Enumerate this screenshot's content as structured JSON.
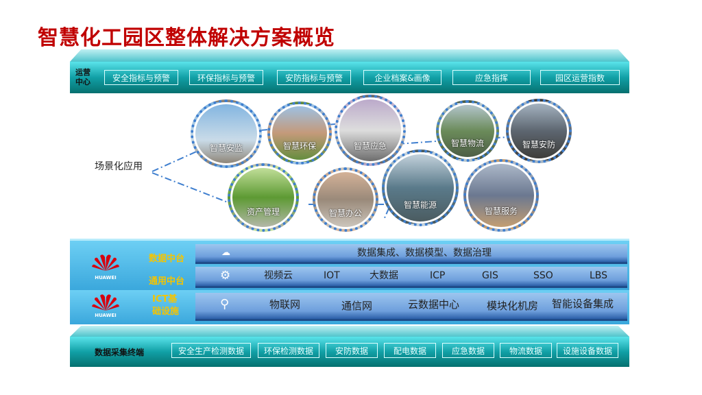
{
  "title": "智慧化工园区整体解决方案概览",
  "ops": {
    "label": "运营中心",
    "buttons": [
      "安全指标与预警",
      "环保指标与预警",
      "安防指标与预警",
      "企业档案&画像",
      "应急指挥",
      "园区运营指数"
    ]
  },
  "scenes": {
    "label": "场景化应用",
    "items": [
      "智慧安监",
      "智慧环保",
      "智慧应急",
      "智慧物流",
      "智慧安防",
      "资产管理",
      "智慧办公",
      "智慧能源",
      "智慧服务"
    ]
  },
  "platform": {
    "brand": "HUAWEI",
    "data_label": "数据中台",
    "general_label": "通用中台",
    "data_text": "数据集成、数据模型、数据治理",
    "general_items": [
      "视频云",
      "IOT",
      "大数据",
      "ICP",
      "GIS",
      "SSO",
      "LBS"
    ]
  },
  "ict": {
    "brand": "HUAWEI",
    "label": "ICT基础设施",
    "items": [
      "物联网",
      "通信网",
      "云数据中心",
      "模块化机房",
      "智能设备集成"
    ]
  },
  "terminal": {
    "label": "数据采集终端",
    "buttons": [
      "安全生产检测数据",
      "环保检测数据",
      "安防数据",
      "配电数据",
      "应急数据",
      "物流数据",
      "设施设备数据"
    ]
  }
}
